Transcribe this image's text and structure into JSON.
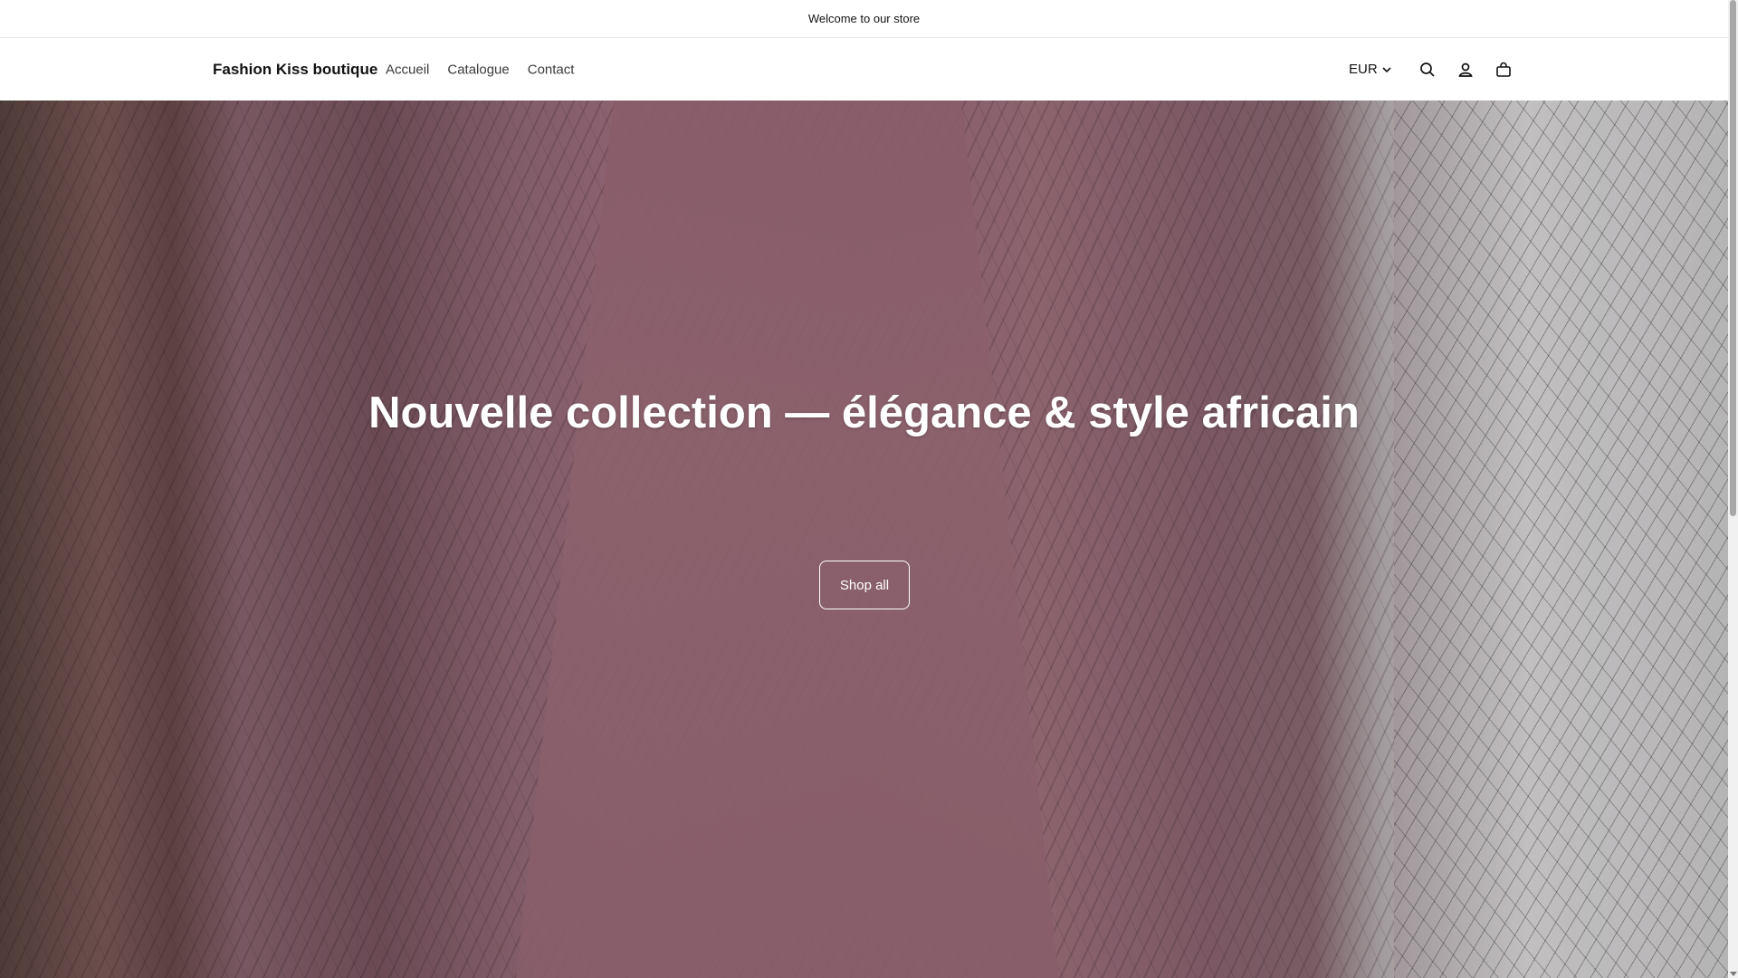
{
  "announcement": {
    "text": "Welcome to our store"
  },
  "header": {
    "brand": "Fashion Kiss boutique",
    "nav": [
      {
        "label": "Accueil"
      },
      {
        "label": "Catalogue"
      },
      {
        "label": "Contact"
      }
    ],
    "currency": "EUR",
    "icons": [
      "chevron-down-icon",
      "search-icon",
      "account-icon",
      "cart-icon"
    ]
  },
  "hero": {
    "title": "Nouvelle collection — élégance & style africain",
    "button_label": "Shop all"
  },
  "colors": {
    "text": "#121212",
    "hero_text": "#ffffff",
    "background": "#ffffff"
  }
}
